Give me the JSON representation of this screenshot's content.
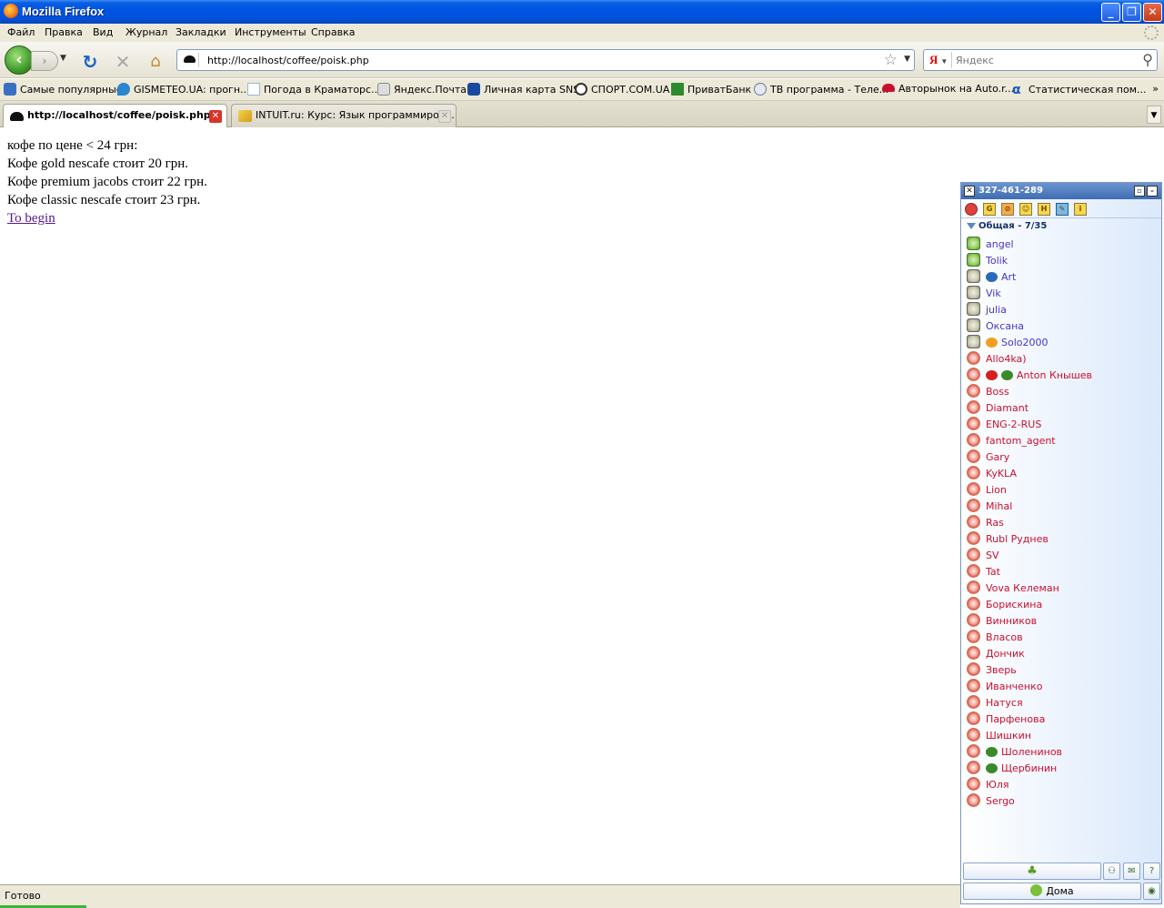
{
  "window": {
    "title": "Mozilla Firefox",
    "minimize": "_",
    "maximize": "❐",
    "close": "✕"
  },
  "menu": [
    "Файл",
    "Правка",
    "Вид",
    "Журнал",
    "Закладки",
    "Инструменты",
    "Справка"
  ],
  "nav": {
    "url": "http://localhost/coffee/poisk.php",
    "search_engine": "Я",
    "search_placeholder": "Яндекс"
  },
  "bookmarks": [
    {
      "label": "Самые популярные",
      "icon": "popular-icon",
      "color": "#3a6fc4"
    },
    {
      "label": "GISMETEO.UA: прогн...",
      "icon": "water-drop-icon",
      "color": "#2a86d0"
    },
    {
      "label": "Погода в Краматорс...",
      "icon": "page-icon",
      "color": "#9db4d8"
    },
    {
      "label": "Яндекс.Почта",
      "icon": "mail-icon",
      "color": "#888888"
    },
    {
      "label": "Личная карта SNS",
      "icon": "sns-icon",
      "color": "#1a4aa0"
    },
    {
      "label": "СПОРТ.COM.UA",
      "icon": "ball-icon",
      "color": "#333333"
    },
    {
      "label": "ПриватБанк",
      "icon": "privatbank-icon",
      "color": "#2d8a2d"
    },
    {
      "label": "ТВ программа - Теле...",
      "icon": "tv-icon",
      "color": "#6a7a9a"
    },
    {
      "label": "Авторынок на Auto.r...",
      "icon": "car-icon",
      "color": "#c8102e"
    },
    {
      "label": "Статистическая пом...",
      "icon": "alpha-icon",
      "color": "#1a5ab8"
    }
  ],
  "bookmarks_more": "»",
  "tabs": [
    {
      "label": "http://localhost/coffee/poisk.php",
      "active": true
    },
    {
      "label": "INTUIT.ru: Курс: Язык программиров...",
      "active": false
    }
  ],
  "page": {
    "lines": [
      "кофе по цене < 24 грн:",
      "Кофе gold nescafe стоит 20 грн.",
      "Кофе premium jacobs стоит 22 грн.",
      "Кофе classic nescafe стоит 23 грн."
    ],
    "link": "To begin"
  },
  "icq": {
    "uin": "327-461-289",
    "group": "Общая - 7/35",
    "contacts": [
      {
        "name": "angel",
        "status": "online"
      },
      {
        "name": "Tolik",
        "status": "online"
      },
      {
        "name": "Art",
        "status": "away",
        "extra": "cap-icon"
      },
      {
        "name": "Vik",
        "status": "away"
      },
      {
        "name": "julia",
        "status": "away"
      },
      {
        "name": "Оксана",
        "status": "away"
      },
      {
        "name": "Solo2000",
        "status": "away",
        "extra": "mood-icon"
      },
      {
        "name": "Allo4ka)",
        "status": "offline"
      },
      {
        "name": "Anton Кнышев",
        "status": "offline",
        "extra": "alert-eye-icon"
      },
      {
        "name": "Boss",
        "status": "offline"
      },
      {
        "name": "Diamant",
        "status": "offline"
      },
      {
        "name": "ENG-2-RUS",
        "status": "offline"
      },
      {
        "name": "fantom_agent",
        "status": "offline"
      },
      {
        "name": "Gary",
        "status": "offline"
      },
      {
        "name": "KyKLA",
        "status": "offline"
      },
      {
        "name": "Lion",
        "status": "offline"
      },
      {
        "name": "Mihal",
        "status": "offline"
      },
      {
        "name": "Ras",
        "status": "offline"
      },
      {
        "name": "Rubl Руднев",
        "status": "offline"
      },
      {
        "name": "SV",
        "status": "offline"
      },
      {
        "name": "Tat",
        "status": "offline"
      },
      {
        "name": "Vova Келеман",
        "status": "offline"
      },
      {
        "name": "Борискина",
        "status": "offline"
      },
      {
        "name": "Винников",
        "status": "offline"
      },
      {
        "name": "Власов",
        "status": "offline"
      },
      {
        "name": "Дончик",
        "status": "offline"
      },
      {
        "name": "Зверь",
        "status": "offline"
      },
      {
        "name": "Иванченко",
        "status": "offline"
      },
      {
        "name": "Натуся",
        "status": "offline"
      },
      {
        "name": "Парфенова",
        "status": "offline"
      },
      {
        "name": "Шишкин",
        "status": "offline"
      },
      {
        "name": "Шоленинов",
        "status": "offline",
        "extra": "eye-icon"
      },
      {
        "name": "Щербинин",
        "status": "offline",
        "extra": "eye-icon"
      },
      {
        "name": "Юля",
        "status": "offline"
      },
      {
        "name": "Sergo",
        "status": "offline"
      }
    ],
    "status_button": "Дома",
    "colors": {
      "online": "#4236c4",
      "offline": "#c8102e"
    }
  },
  "status_bar": "Готово"
}
